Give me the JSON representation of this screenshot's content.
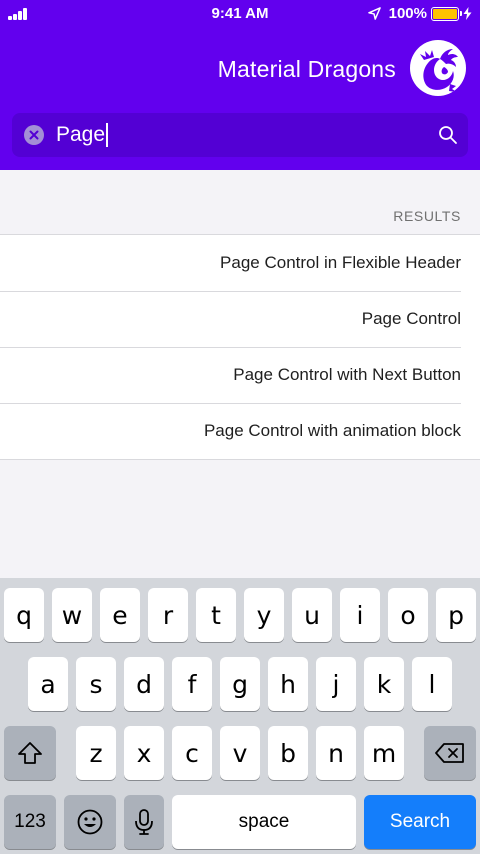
{
  "status_bar": {
    "time": "9:41 AM",
    "battery_percent": "100%",
    "battery_level": 1.0,
    "battery_color": "#ffc400"
  },
  "header": {
    "title": "Material Dragons",
    "logo_icon": "dragon-logo-icon",
    "background_color": "#6200ee"
  },
  "search": {
    "query": "Page",
    "clear_icon": "clear-icon",
    "search_icon": "search-icon"
  },
  "results": {
    "section_title": "RESULTS",
    "items": [
      {
        "label": "Page Control in Flexible Header"
      },
      {
        "label": "Page Control"
      },
      {
        "label": "Page Control with Next Button"
      },
      {
        "label": "Page Control with animation block"
      }
    ]
  },
  "keyboard": {
    "row1": [
      "q",
      "w",
      "e",
      "r",
      "t",
      "y",
      "u",
      "i",
      "o",
      "p"
    ],
    "row2": [
      "a",
      "s",
      "d",
      "f",
      "g",
      "h",
      "j",
      "k",
      "l"
    ],
    "row3": [
      "z",
      "x",
      "c",
      "v",
      "b",
      "n",
      "m"
    ],
    "numbers_label": "123",
    "space_label": "space",
    "search_label": "Search",
    "shift_icon": "shift-icon",
    "backspace_icon": "backspace-icon",
    "emoji_icon": "emoji-icon",
    "mic_icon": "microphone-icon",
    "search_key_color": "#147efb"
  }
}
